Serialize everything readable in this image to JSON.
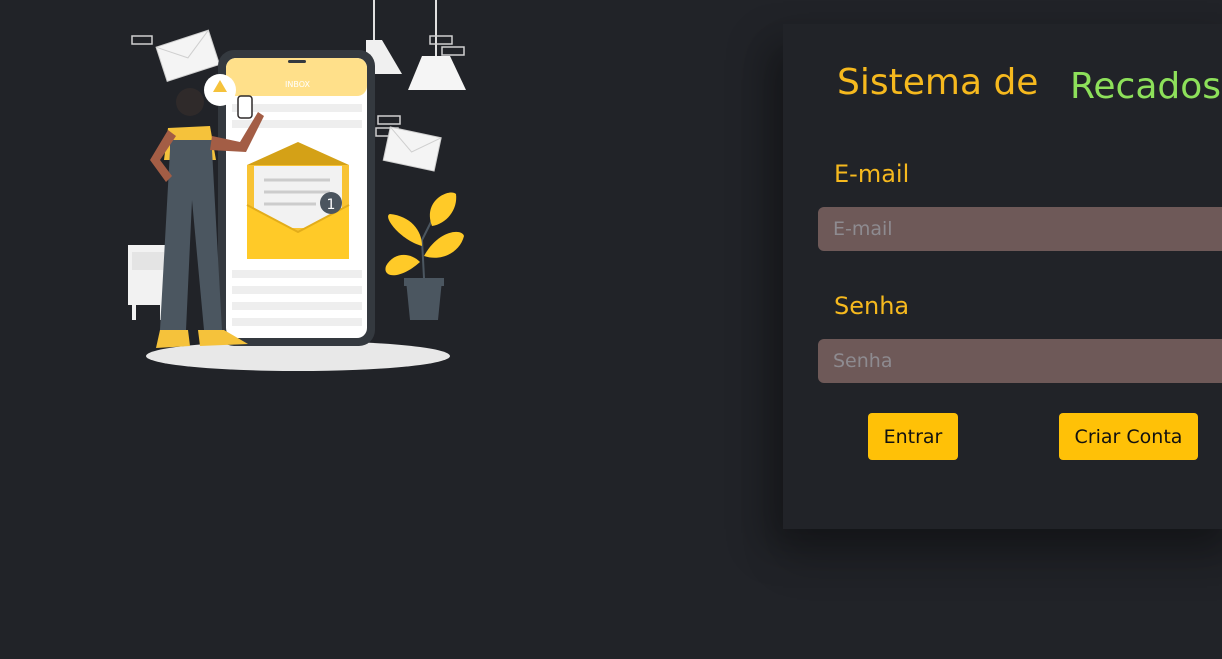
{
  "title": {
    "part1": "Sistema de",
    "part2": "Recados"
  },
  "form": {
    "email_label": "E-mail",
    "email_placeholder": "E-mail",
    "email_value": "",
    "password_label": "Senha",
    "password_placeholder": "Senha",
    "password_value": ""
  },
  "buttons": {
    "login_label": "Entrar",
    "create_account_label": "Criar Conta"
  },
  "illustration": {
    "phone_screen_header": "INBOX",
    "notification_count": "1"
  },
  "colors": {
    "background": "#212328",
    "accent_yellow": "#f6b91e",
    "accent_green": "#8de05a",
    "input_bg": "#6e5958",
    "button_bg": "#ffc107"
  }
}
